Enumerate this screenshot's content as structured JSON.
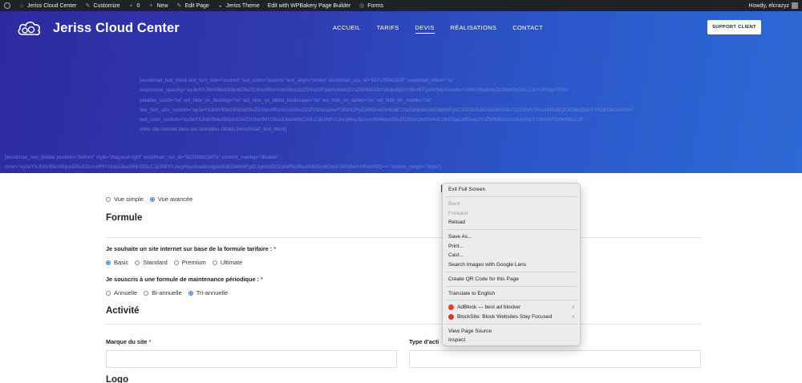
{
  "admin_bar": {
    "site_name": "Jeriss Cloud Center",
    "customize": "Customize",
    "comments_count": "0",
    "new_label": "New",
    "edit_page": "Edit Page",
    "theme": "Jeriss Theme",
    "wpbakery": "Edit with WPBakery Page Builder",
    "forms": "Forms",
    "howdy": "Howdy, elcrazyz"
  },
  "header": {
    "brand": "Jeriss Cloud Center",
    "nav": [
      "ACCUEIL",
      "TARIFS",
      "DEVIS",
      "RÉALISATIONS",
      "CONTACT"
    ],
    "active_nav": "DEVIS",
    "support_button": "SUPPORT CLIENT",
    "shortcode_lines": [
      "[woodmart_text_block text_font_size=\"custom\" text_color=\"custom\" text_align=\"center\" woodmart_css_id=\"627c0f541332f\" woodmart_inline=\"no\"",
      "responsive_spacing=\"eyJwYXJhbV90eXBlIjoid29vZG1hcnRfcmVzcG9uc2l2ZV9zcGFjaW5nIiwic2VsZWN0b3JzX2lkIjoiNjI3YzBmNTQxMzMyZiIsInNoYXBlX2RpdmlkZXJfaWQiOiIiLCJkYXRhIjp7fX0=\"",
      "parallax_scroll=\"no\" wd_hide_on_desktop=\"no\" wd_hide_on_tablet_landscape=\"no\" wd_hide_on_tablet=\"no\" wd_hide_on_mobile=\"no\"",
      "text_font_size_custom=\"eyJwYXJhbV90eXBlIjoid29vZG1hcnRfcmVzcG9uc2l2ZV9zaXplIiwiY3NzX2FyZ3MiOnsiZm9udC1zaXplIjpbIi53b29kbWFydC10ZXh0LWJsb2NrIl19LCJzZWxlY3RvcnNfaWQiOiI2MjdjMGY1NDEzMzJmIn0=\"",
      "text_color_custom=\"eyJwYXJhbV90eXBlIjoid29vZG1hcnRfY29sb3JwaWNrZXIiLCJjc3NfYXJncyI6eyJjb2xvciI6WyIud29vZG1hcnQtdGV4dC1ibG9jayJdfSwic2VsZWN0b3JzX2lkIjoiNjI3YzBmNTQxMzMyZiJ9\"",
      "votre site internet dans ses moindres détails.[/woodmart_text_block]"
    ],
    "row_divider_lines": [
      "[woodmart_row_divider position=\"bottom\" style=\"diagonal-right\" woodmart_css_id=\"6225fdd12ef7e\" content_overlap=\"disable\"",
      "color=\"eyJwYXJhbV90eXBlIjoid29vZG1hcnRfY29sb3JwaWNrZXIiLCJjc3NfYXJncyI6eyJmaWxsIjpbIi53b29kbWFydC1yb3ctZGl2aWRlci0ke3NlbGVjdG9yX2lkfSBwYXRoIl19fQ==\" custom_height=\"80px\"]"
    ]
  },
  "form": {
    "view_simple": "Vue simple",
    "view_advanced": "Vue avancée",
    "section_formule": "Formule",
    "q_formule": "Je souhaite un site internet sur base de la formule tarifaire :",
    "formule_options": [
      "Basic",
      "Standard",
      "Premium",
      "Ultimate"
    ],
    "formule_selected": "Basic",
    "q_maintenance": "Je souscris à une formule de maintenance périodique :",
    "maintenance_options": [
      "Annuelle",
      "Bi-annuelle",
      "Tri-annuelle"
    ],
    "maintenance_selected": "Tri-annuelle",
    "section_activite": "Activité",
    "label_marque": "Marque du site",
    "label_type": "Type d'acti",
    "required_mark": "*",
    "section_logo": "Logo"
  },
  "context_menu": {
    "items": [
      {
        "label": "Exit Full Screen",
        "disabled": false
      },
      {
        "sep": true
      },
      {
        "label": "Back",
        "disabled": true
      },
      {
        "label": "Forward",
        "disabled": true
      },
      {
        "label": "Reload",
        "disabled": false
      },
      {
        "sep": true
      },
      {
        "label": "Save As...",
        "disabled": false
      },
      {
        "label": "Print...",
        "disabled": false
      },
      {
        "label": "Cast...",
        "disabled": false
      },
      {
        "label": "Search Images with Google Lens",
        "disabled": false
      },
      {
        "sep": true
      },
      {
        "label": "Create QR Code for this Page",
        "disabled": false
      },
      {
        "sep": true
      },
      {
        "label": "Translate to English",
        "disabled": false
      },
      {
        "sep": true
      },
      {
        "label": "AdBlock — best ad blocker",
        "disabled": false,
        "icon": "adblock-icon",
        "icon_color": "#e2412f",
        "submenu": true
      },
      {
        "label": "BlockSite: Block Websites  Stay Focused",
        "disabled": false,
        "icon": "blocksite-icon",
        "icon_color": "#d9342b",
        "submenu": true
      },
      {
        "sep": true
      },
      {
        "label": "View Page Source",
        "disabled": false
      },
      {
        "label": "Inspect",
        "disabled": false
      }
    ]
  },
  "colors": {
    "admin_bar": "#1d2327",
    "hero_start": "#2d2aa0",
    "hero_end": "#2d6ad6",
    "radio_accent": "#2f7de1"
  }
}
